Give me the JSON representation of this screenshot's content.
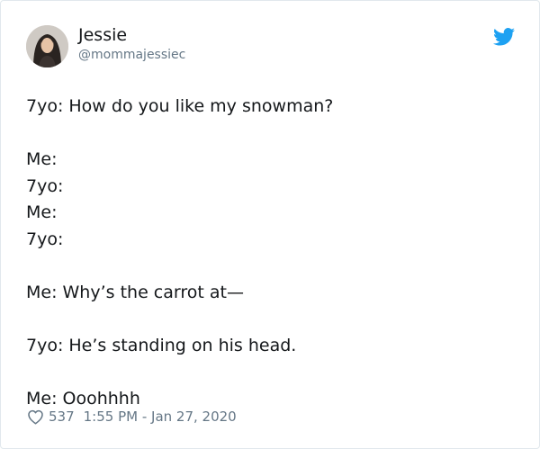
{
  "tweet": {
    "author": {
      "display_name": "Jessie",
      "handle": "@mommajessiec"
    },
    "icons": {
      "brand": "twitter-bird-icon",
      "like": "heart-outline-icon"
    },
    "colors": {
      "twitter_blue": "#1da1f2",
      "secondary_text": "#657786"
    },
    "body_lines": [
      "7yo: How do you like my snowman?",
      "Me:",
      "7yo:",
      "Me:",
      "7yo:",
      "Me: Why’s the carrot at—",
      "7yo: He’s standing on his head.",
      "Me: Ooohhhh"
    ],
    "likes": "537",
    "timestamp": "1:55 PM - Jan 27, 2020"
  }
}
